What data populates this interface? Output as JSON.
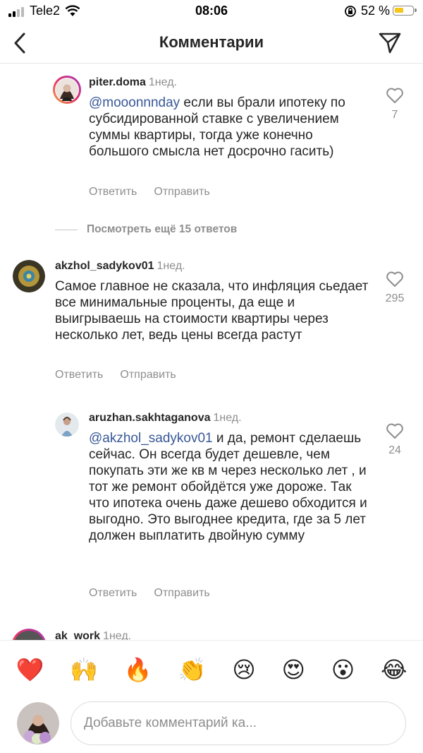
{
  "status_bar": {
    "carrier": "Tele2",
    "time": "08:06",
    "battery_percent": "52 %",
    "battery_level": 0.52
  },
  "header": {
    "title": "Комментарии"
  },
  "comments": [
    {
      "username": "piter.doma",
      "time": "1нед.",
      "mention": "@mooonnnday",
      "text": " если вы брали ипотеку по субсидированной ставке с увеличением суммы квартиры, тогда уже конечно большого смысла нет досрочно гасить)",
      "likes": "7",
      "reply_label": "Ответить",
      "send_label": "Отправить"
    },
    {
      "username": "akzhol_sadykov01",
      "time": "1нед.",
      "mention": "",
      "text": "Самое главное не сказала, что инфляция сьедает все минимальные проценты, да еще и выигрываешь на стоимости квартиры через несколько лет, ведь цены всегда растут",
      "likes": "295",
      "reply_label": "Ответить",
      "send_label": "Отправить"
    },
    {
      "username": "aruzhan.sakhtaganova",
      "time": "1нед.",
      "mention": "@akzhol_sadykov01",
      "text": " и да, ремонт сделаешь сейчас. Он всегда будет дешевле, чем покупать эти же кв м через несколько лет , и тот же ремонт обойдётся уже дороже. Так что ипотека очень даже дешево обходится и выгодно. Это выгоднее кредита, где за 5 лет должен выплатить двойную сумму",
      "likes": "24",
      "reply_label": "Ответить",
      "send_label": "Отправить"
    },
    {
      "username": "ak_work",
      "time": "1нед."
    }
  ],
  "more_replies": "Посмотреть ещё 15 ответов",
  "emojis": [
    "❤️",
    "🙌",
    "🔥",
    "👏",
    "😢",
    "😍",
    "😮",
    "😂"
  ],
  "input": {
    "placeholder": "Добавьте комментарий ка..."
  }
}
